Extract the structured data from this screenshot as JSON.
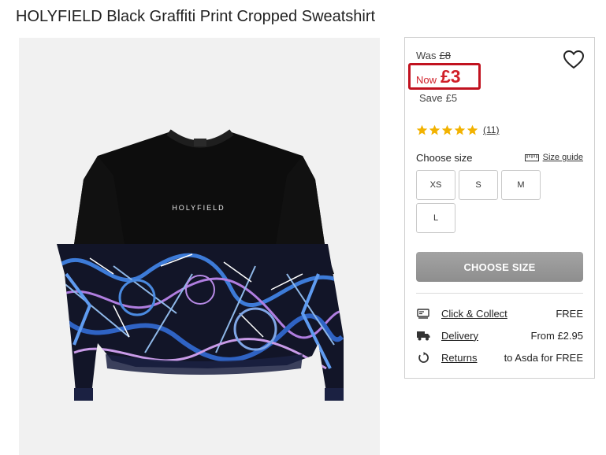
{
  "product": {
    "title": "HOLYFIELD Black Graffiti Print Cropped Sweatshirt",
    "brand_print": "HOLYFIELD"
  },
  "price": {
    "was_label": "Was",
    "was_value": "£8",
    "now_label": "Now",
    "now_value": "£3",
    "save_label": "Save",
    "save_value": "£5",
    "accent_color": "#d01f28"
  },
  "rating": {
    "stars": 5,
    "count": "(11)",
    "star_color": "#f2b200"
  },
  "size": {
    "label": "Choose size",
    "guide_label": "Size guide",
    "options": [
      "XS",
      "S",
      "M",
      "L"
    ]
  },
  "cta": {
    "label": "CHOOSE SIZE"
  },
  "delivery": [
    {
      "icon": "click-collect-icon",
      "label": "Click & Collect",
      "value": "FREE"
    },
    {
      "icon": "truck-icon",
      "label": "Delivery",
      "value": "From £2.95"
    },
    {
      "icon": "returns-icon",
      "label": "Returns",
      "value": "to Asda for FREE"
    }
  ]
}
